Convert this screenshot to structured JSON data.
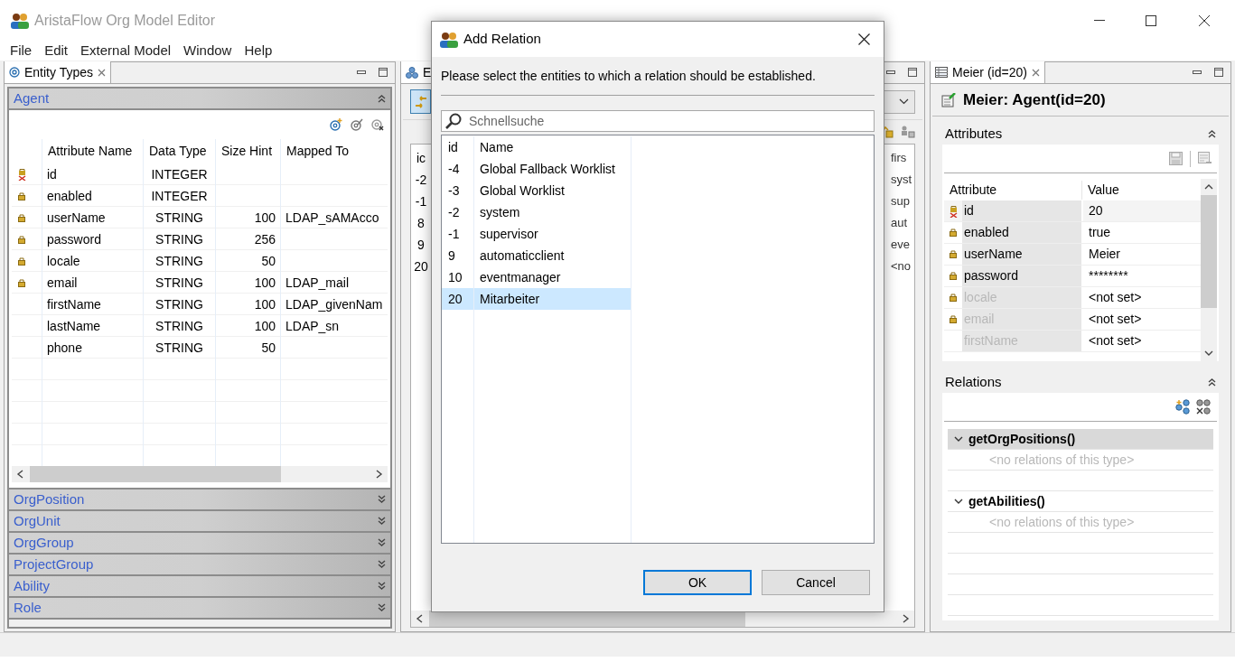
{
  "window": {
    "title": "AristaFlow Org Model Editor"
  },
  "menu": [
    "File",
    "Edit",
    "External Model",
    "Window",
    "Help"
  ],
  "entity_types_view": {
    "tab": "Entity Types",
    "sections": [
      {
        "label": "Agent",
        "expanded": true
      },
      {
        "label": "OrgPosition",
        "expanded": false
      },
      {
        "label": "OrgUnit",
        "expanded": false
      },
      {
        "label": "OrgGroup",
        "expanded": false
      },
      {
        "label": "ProjectGroup",
        "expanded": false
      },
      {
        "label": "Ability",
        "expanded": false
      },
      {
        "label": "Role",
        "expanded": false
      }
    ],
    "columns": [
      "Attribute Name",
      "Data Type",
      "Size Hint",
      "Mapped To"
    ],
    "rows": [
      {
        "kind": "primary",
        "name": "id",
        "type": "INTEGER"
      },
      {
        "kind": "locked",
        "name": "enabled",
        "type": "INTEGER"
      },
      {
        "kind": "locked",
        "name": "userName",
        "type": "STRING",
        "size": "100",
        "mapped": "LDAP_sAMAcco"
      },
      {
        "kind": "locked",
        "name": "password",
        "type": "STRING",
        "size": "256"
      },
      {
        "kind": "locked",
        "name": "locale",
        "type": "STRING",
        "size": "50"
      },
      {
        "kind": "locked",
        "name": "email",
        "type": "STRING",
        "size": "100",
        "mapped": "LDAP_mail"
      },
      {
        "kind": "plain",
        "name": "firstName",
        "type": "STRING",
        "size": "100",
        "mapped": "LDAP_givenNam"
      },
      {
        "kind": "plain",
        "name": "lastName",
        "type": "STRING",
        "size": "100",
        "mapped": "LDAP_sn"
      },
      {
        "kind": "plain",
        "name": "phone",
        "type": "STRING",
        "size": "50"
      }
    ]
  },
  "entities_view": {
    "tab": "E",
    "column_1": [
      "ic",
      "-2",
      "-1",
      "8",
      "9",
      "20"
    ],
    "column_2": [
      "firs",
      "syst",
      "sup",
      "aut",
      "eve",
      "<no"
    ]
  },
  "dialog": {
    "title": "Add Relation",
    "message": "Please select the entities to which a relation should be established.",
    "search": {
      "placeholder": "Schnellsuche"
    },
    "columns": [
      "id",
      "Name"
    ],
    "rows": [
      {
        "id": "-4",
        "name": "Global Fallback Worklist",
        "selected": false
      },
      {
        "id": "-3",
        "name": "Global Worklist",
        "selected": false
      },
      {
        "id": "-2",
        "name": "system",
        "selected": false
      },
      {
        "id": "-1",
        "name": "supervisor",
        "selected": false
      },
      {
        "id": "9",
        "name": "automaticclient",
        "selected": false
      },
      {
        "id": "10",
        "name": "eventmanager",
        "selected": false
      },
      {
        "id": "20",
        "name": "Mitarbeiter",
        "selected": true
      }
    ],
    "buttons": [
      {
        "label": "OK",
        "default": true
      },
      {
        "label": "Cancel",
        "default": false
      }
    ]
  },
  "detail_view": {
    "tab": "Meier (id=20)",
    "heading": "Meier: Agent(id=20)",
    "attributes": {
      "title": "Attributes",
      "expanded": true,
      "columns": [
        "Attribute",
        "Value"
      ],
      "rows": [
        {
          "kind": "primary",
          "name": "id",
          "value": "20",
          "set": true
        },
        {
          "kind": "locked",
          "name": "enabled",
          "value": "true",
          "set": true
        },
        {
          "kind": "locked",
          "name": "userName",
          "value": "Meier",
          "set": true
        },
        {
          "kind": "locked",
          "name": "password",
          "value": "********",
          "set": true
        },
        {
          "kind": "locked",
          "name": "locale",
          "value": "<not set>",
          "set": false
        },
        {
          "kind": "locked",
          "name": "email",
          "value": "<not set>",
          "set": false
        },
        {
          "kind": "plain",
          "name": "firstName",
          "value": "<not set>",
          "set": false
        }
      ]
    },
    "relations": {
      "title": "Relations",
      "expanded": true,
      "groups": [
        {
          "label": "getOrgPositions()",
          "expanded": true,
          "selected": true,
          "empty_text": "<no relations of this type>"
        },
        {
          "label": "getAbilities()",
          "expanded": true,
          "selected": false,
          "empty_text": "<no relations of this type>"
        }
      ]
    }
  }
}
